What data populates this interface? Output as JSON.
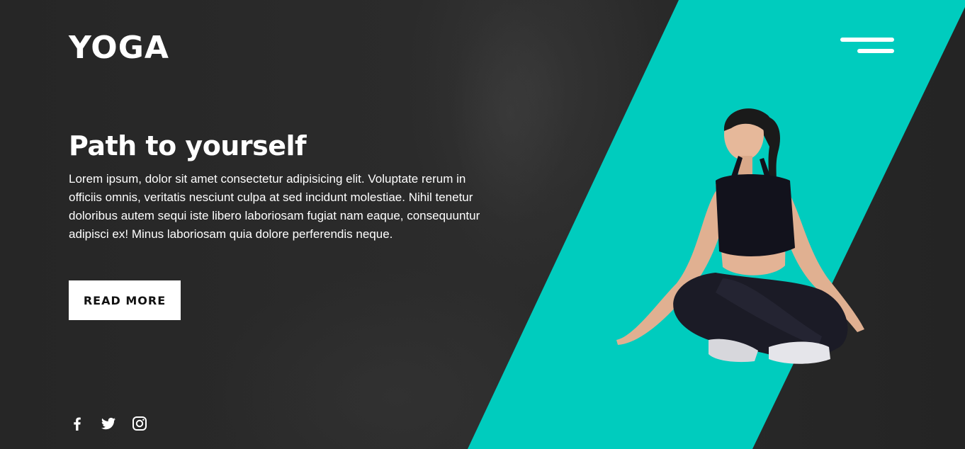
{
  "brand": {
    "logo": "YOGA"
  },
  "hero": {
    "title": "Path to yourself",
    "text": "Lorem ipsum, dolor sit amet consectetur adipisicing elit. Voluptate rerum in officiis omnis, veritatis nesciunt culpa at sed incidunt molestiae. Nihil tenetur doloribus autem sequi iste libero laboriosam fugiat nam eaque, consequuntur adipisci ex! Minus laboriosam quia dolore perferendis neque.",
    "button_label": "READ MORE"
  },
  "social": [
    {
      "icon": "facebook-icon"
    },
    {
      "icon": "twitter-icon"
    },
    {
      "icon": "instagram-icon"
    }
  ],
  "colors": {
    "accent": "#00CCBE",
    "background": "#2A2A2A",
    "text": "#FFFFFF"
  }
}
